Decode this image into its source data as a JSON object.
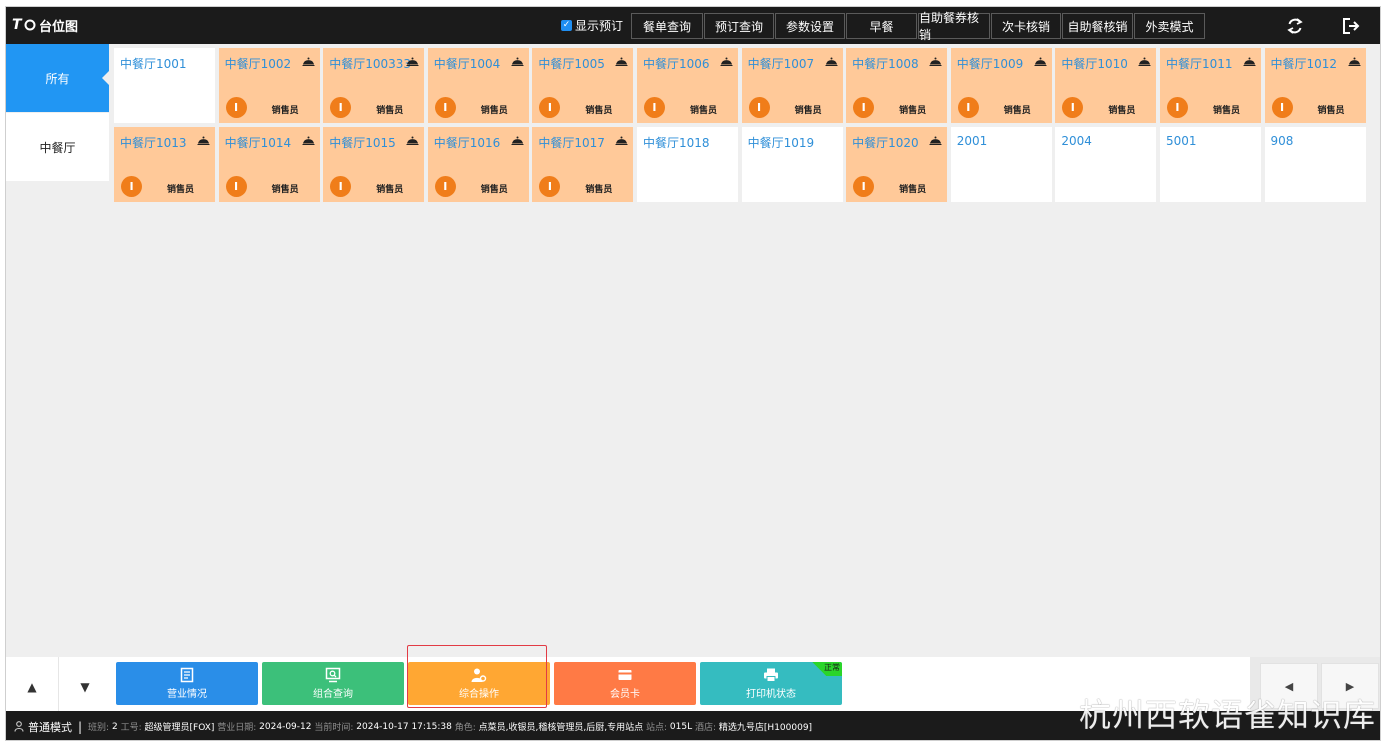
{
  "app": {
    "title": "台位图",
    "logo_text": "T"
  },
  "toolbar": {
    "show_booking_label": "显示预订",
    "show_booking_checked": true,
    "buttons": [
      {
        "label": "餐单查询"
      },
      {
        "label": "预订查询"
      },
      {
        "label": "参数设置"
      },
      {
        "label": "早餐"
      },
      {
        "label": "自助餐券核销"
      },
      {
        "label": "次卡核销"
      },
      {
        "label": "自助餐核销"
      },
      {
        "label": "外卖模式"
      }
    ],
    "refresh_icon": "refresh-icon",
    "logout_icon": "logout-icon"
  },
  "categories": [
    {
      "label": "所有",
      "active": true
    },
    {
      "label": "中餐厅",
      "active": false
    }
  ],
  "tables": [
    {
      "name": "中餐厅1001",
      "occupied": false
    },
    {
      "name": "中餐厅1002",
      "occupied": true,
      "staff": "销售员"
    },
    {
      "name": "中餐厅100333",
      "occupied": true,
      "staff": "销售员"
    },
    {
      "name": "中餐厅1004",
      "occupied": true,
      "staff": "销售员"
    },
    {
      "name": "中餐厅1005",
      "occupied": true,
      "staff": "销售员"
    },
    {
      "name": "中餐厅1006",
      "occupied": true,
      "staff": "销售员"
    },
    {
      "name": "中餐厅1007",
      "occupied": true,
      "staff": "销售员"
    },
    {
      "name": "中餐厅1008",
      "occupied": true,
      "staff": "销售员"
    },
    {
      "name": "中餐厅1009",
      "occupied": true,
      "staff": "销售员"
    },
    {
      "name": "中餐厅1010",
      "occupied": true,
      "staff": "销售员"
    },
    {
      "name": "中餐厅1011",
      "occupied": true,
      "staff": "销售员"
    },
    {
      "name": "中餐厅1012",
      "occupied": true,
      "staff": "销售员"
    },
    {
      "name": "中餐厅1013",
      "occupied": true,
      "staff": "销售员"
    },
    {
      "name": "中餐厅1014",
      "occupied": true,
      "staff": "销售员"
    },
    {
      "name": "中餐厅1015",
      "occupied": true,
      "staff": "销售员"
    },
    {
      "name": "中餐厅1016",
      "occupied": true,
      "staff": "销售员"
    },
    {
      "name": "中餐厅1017",
      "occupied": true,
      "staff": "销售员"
    },
    {
      "name": "中餐厅1018",
      "occupied": false
    },
    {
      "name": "中餐厅1019",
      "occupied": false
    },
    {
      "name": "中餐厅1020",
      "occupied": true,
      "staff": "销售员"
    },
    {
      "name": "2001",
      "occupied": false
    },
    {
      "name": "2004",
      "occupied": false
    },
    {
      "name": "5001",
      "occupied": false
    },
    {
      "name": "908",
      "occupied": false
    }
  ],
  "staff_badge_letter": "I",
  "actions": [
    {
      "label": "营业情况",
      "color": "#2a8ee8",
      "icon": "report-icon"
    },
    {
      "label": "组合查询",
      "color": "#3cc07a",
      "icon": "combo-query-icon"
    },
    {
      "label": "综合操作",
      "color": "#ffa733",
      "icon": "user-settings-icon"
    },
    {
      "label": "会员卡",
      "color": "#ff7a45",
      "icon": "card-icon"
    },
    {
      "label": "打印机状态",
      "color": "#35bcc0",
      "icon": "printer-icon",
      "status": "正常"
    }
  ],
  "nav": {
    "up": "▲",
    "down": "▼",
    "prev": "◀",
    "next": "▶"
  },
  "status": {
    "mode": "普通模式",
    "shift_label": "班别:",
    "shift": "2",
    "job_label": "工号:",
    "job": "超级管理员[FOX]",
    "business_date_label": "营业日期:",
    "business_date": "2024-09-12",
    "current_time_label": "当前时间:",
    "current_time": "2024-10-17 17:15:38",
    "role_label": "角色:",
    "role": "点菜员,收银员,稽核管理员,后厨,专用站点",
    "station_label": "站点:",
    "station": "015L",
    "hotel_label": "酒店:",
    "hotel": "精选九号店[H100009]"
  },
  "watermark": "杭州西软语雀知识库"
}
